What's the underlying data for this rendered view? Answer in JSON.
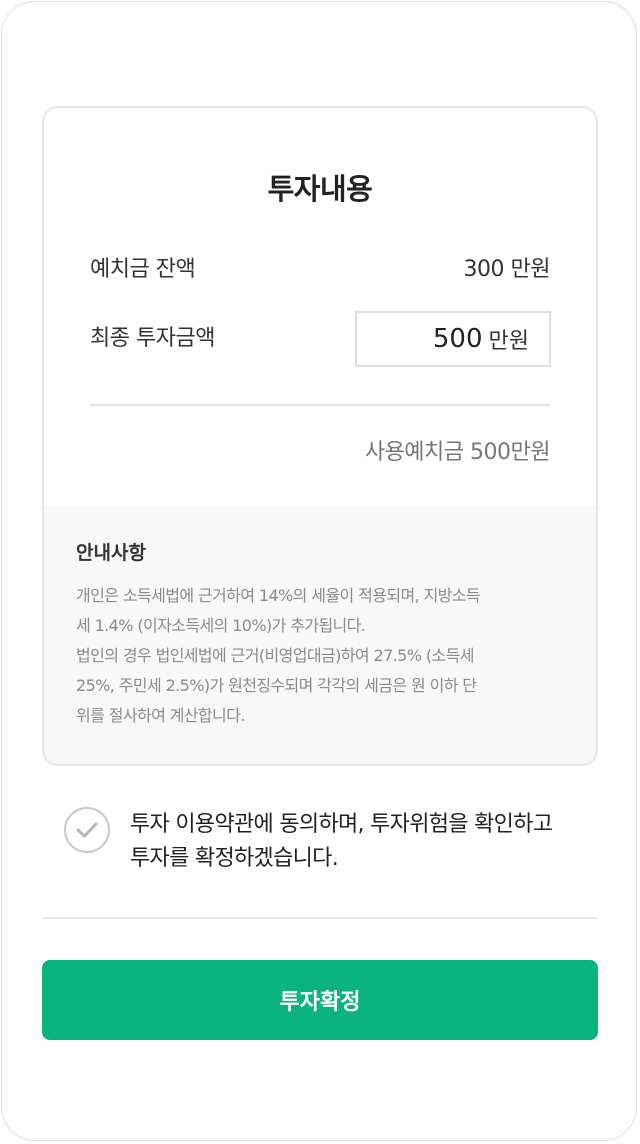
{
  "card": {
    "title": "투자내용",
    "deposit_label": "예치금 잔액",
    "deposit_value": "300 만원",
    "final_label": "최종 투자금액",
    "amount_value": "500",
    "amount_unit": "만원",
    "used_deposit": "사용예치금 500만원"
  },
  "notice": {
    "title": "안내사항",
    "lines": [
      "개인은 소득세법에 근거하여 14%의 세율이 적용되며, 지방소득",
      "세 1.4% (이자소득세의 10%)가 추가됩니다.",
      "법인의 경우 법인세법에 근거(비영업대금)하여 27.5% (소득세",
      "25%, 주민세 2.5%)가 원천징수되며 각각의 세금은 원 이하 단",
      "위를 절사하여 계산합니다."
    ]
  },
  "agreement": {
    "checked": true,
    "line1": "투자 이용약관에 동의하며, 투자위험을 확인하고",
    "line2": "투자를 확정하겠습니다.",
    "icon": "check-icon"
  },
  "confirm": {
    "label": "투자확정"
  },
  "colors": {
    "accent": "#0bb47f",
    "notice_background": "#f8f8f8",
    "border": "#e6e6e6",
    "muted_text": "#8a8a8a"
  }
}
